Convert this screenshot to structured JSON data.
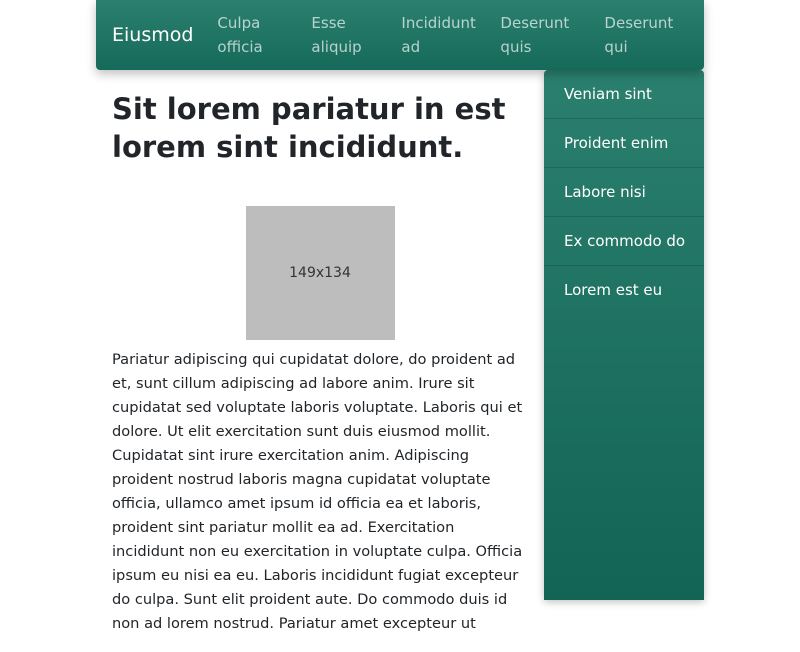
{
  "navbar": {
    "brand": "Eiusmod",
    "links": [
      {
        "label": "Culpa officia"
      },
      {
        "label": "Esse aliquip"
      },
      {
        "label": "Incididunt ad"
      },
      {
        "label": "Deserunt quis"
      },
      {
        "label": "Deserunt qui"
      }
    ]
  },
  "main": {
    "title": "Sit lorem pariatur in est lorem sint incididunt.",
    "image_label": "149x134",
    "paragraph": "Pariatur adipiscing qui cupidatat dolore, do proident ad et, sunt cillum adipiscing ad labore anim. Irure sit cupidatat sed voluptate laboris voluptate. Laboris qui et dolore. Ut elit exercitation sunt duis eiusmod mollit. Cupidatat sint irure exercitation anim. Adipiscing proident nostrud laboris magna cupidatat voluptate officia, ullamco amet ipsum id officia ea et laboris, proident sint pariatur mollit ea ad. Exercitation incididunt non eu exercitation in voluptate culpa. Officia ipsum eu nisi ea eu. Laboris incididunt fugiat excepteur do culpa. Sunt elit proident aute. Do commodo duis id non ad lorem nostrud. Pariatur amet excepteur ut"
  },
  "sidebar": {
    "items": [
      {
        "label": "Veniam sint"
      },
      {
        "label": "Proident enim"
      },
      {
        "label": "Labore nisi"
      },
      {
        "label": "Ex commodo do"
      },
      {
        "label": "Lorem est eu"
      }
    ]
  },
  "colors": {
    "navbar_top": "#2b7f6e",
    "navbar_bottom": "#156a5a",
    "placeholder": "#bdbdbd",
    "text": "#212529"
  }
}
